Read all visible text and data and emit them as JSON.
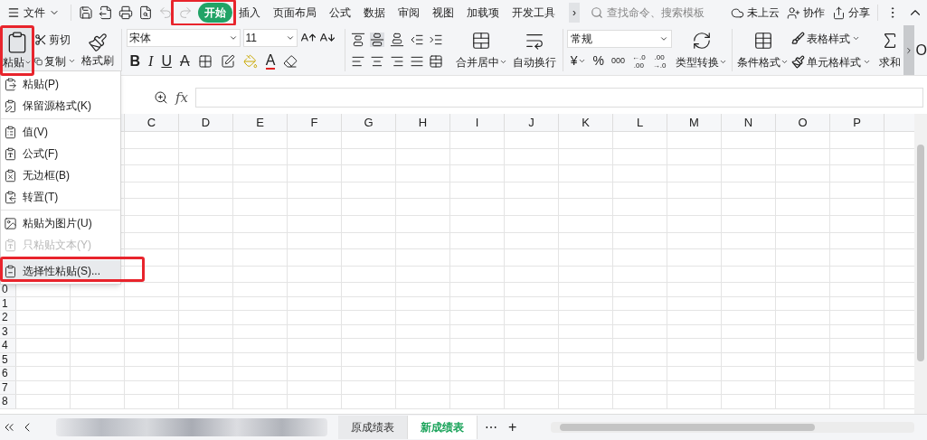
{
  "top_bar": {
    "menu_label": "文件",
    "tabs": [
      {
        "label": "开始",
        "selected": true
      },
      {
        "label": "插入",
        "selected": false
      },
      {
        "label": "页面布局",
        "selected": false
      },
      {
        "label": "公式",
        "selected": false
      },
      {
        "label": "数据",
        "selected": false
      },
      {
        "label": "审阅",
        "selected": false
      },
      {
        "label": "视图",
        "selected": false
      },
      {
        "label": "加载项",
        "selected": false
      },
      {
        "label": "开发工具",
        "selected": false
      }
    ],
    "more": "›",
    "search": {
      "placeholder": "查找命令、搜索模板"
    },
    "actions": [
      "未上云",
      "协作",
      "分享"
    ]
  },
  "ribbon": {
    "paste": "粘贴",
    "cut": "剪切",
    "copy": "复制",
    "format_painter": "格式刷",
    "font": "宋体",
    "font_size": "11",
    "font_buttons": [
      "B",
      "I",
      "U",
      "A"
    ],
    "font_color": "A",
    "merge": "合并居中",
    "wrap": "自动换行",
    "number_format": "常规",
    "number_symbols": [
      "¥",
      "%"
    ],
    "thousands": "000",
    "decimals": [
      {
        "top": "←.0",
        "bottom": ".00"
      },
      {
        "top": ".00",
        "bottom": "→.0"
      }
    ],
    "convert": "类型转换",
    "conditional": "条件格式",
    "table_style": "表格样式",
    "cell_style": "单元格样式",
    "sum": "求和",
    "edge_text": "O"
  },
  "formula_bar": {
    "fx": "fx"
  },
  "columns": [
    "C",
    "D",
    "E",
    "F",
    "G",
    "H",
    "I",
    "J",
    "K",
    "L",
    "M",
    "N",
    "O",
    "P"
  ],
  "rows": [
    "0",
    "1",
    "2",
    "3",
    "4",
    "5",
    "6",
    "7",
    "8"
  ],
  "paste_menu": [
    [
      {
        "label": "粘贴(P)",
        "disabled": false,
        "selected": false
      },
      {
        "label": "保留源格式(K)",
        "disabled": false,
        "selected": false
      }
    ],
    [
      {
        "label": "值(V)",
        "disabled": false,
        "selected": false
      },
      {
        "label": "公式(F)",
        "disabled": false,
        "selected": false
      },
      {
        "label": "无边框(B)",
        "disabled": false,
        "selected": false
      },
      {
        "label": "转置(T)",
        "disabled": false,
        "selected": false
      }
    ],
    [
      {
        "label": "粘贴为图片(U)",
        "disabled": false,
        "selected": false
      },
      {
        "label": "只粘贴文本(Y)",
        "disabled": true,
        "selected": false
      }
    ],
    [
      {
        "label": "选择性粘贴(S)...",
        "disabled": false,
        "selected": true
      }
    ]
  ],
  "sheet_tabs": [
    {
      "label": "原成绩表",
      "selected": false
    },
    {
      "label": "新成绩表",
      "selected": true
    }
  ],
  "sheet_more": "⋯",
  "sheet_add": "+"
}
